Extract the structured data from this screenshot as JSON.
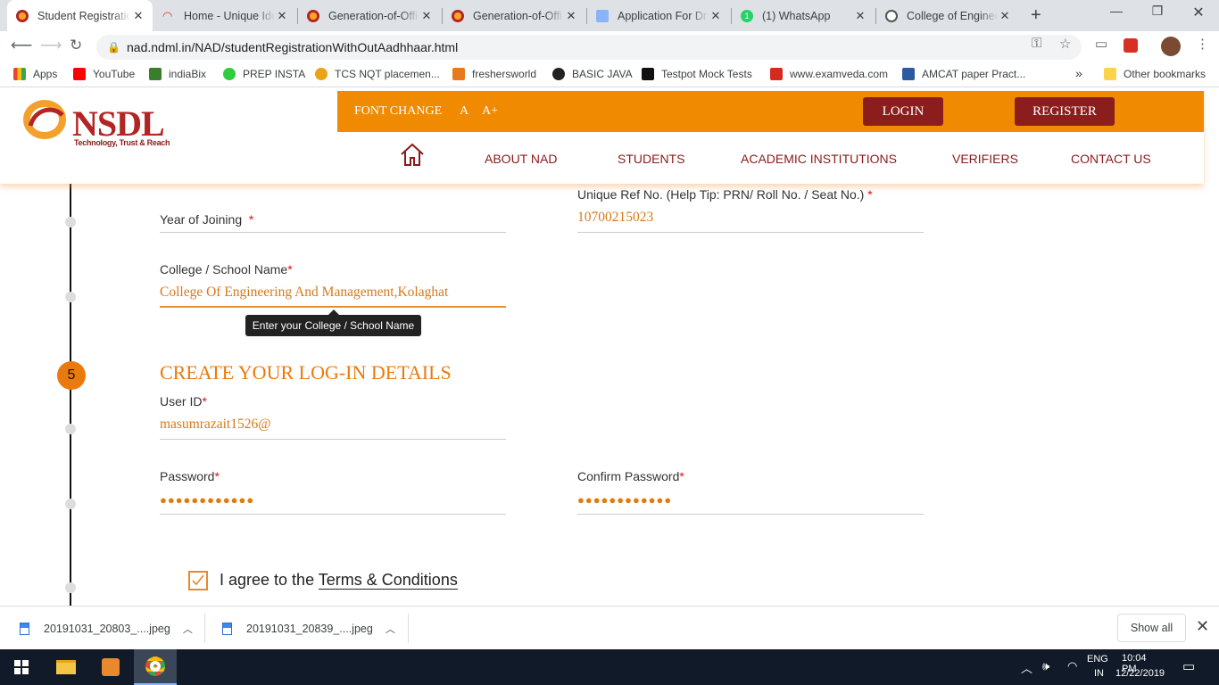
{
  "browser": {
    "tabs": [
      {
        "title": "Student Registratio",
        "active": true,
        "favicon": "nsdl-logo-icon"
      },
      {
        "title": "Home - Unique Ide",
        "active": false,
        "favicon": "wifi-icon"
      },
      {
        "title": "Generation-of-Offi",
        "active": false,
        "favicon": "nsdl-logo-icon"
      },
      {
        "title": "Generation-of-Offi",
        "active": false,
        "favicon": "nsdl-logo-icon"
      },
      {
        "title": "Application For Dr",
        "active": false,
        "favicon": "document-icon"
      },
      {
        "title": "(1) WhatsApp",
        "active": false,
        "favicon": "whatsapp-icon"
      },
      {
        "title": "College of Enginee",
        "active": false,
        "favicon": "college-icon"
      }
    ],
    "url": "nad.ndml.in/NAD/studentRegistrationWithOutAadhhaar.html",
    "bookmarks": [
      {
        "label": "Apps",
        "icon": "apps-grid-icon",
        "color": "#ea4335"
      },
      {
        "label": "YouTube",
        "icon": "youtube-icon",
        "color": "#ff0000"
      },
      {
        "label": "indiaBix",
        "icon": "indiabix-icon",
        "color": "#3a7d2c"
      },
      {
        "label": "PREP INSTA",
        "icon": "prepinsta-icon",
        "color": "#2ecc40"
      },
      {
        "label": "TCS NQT placemen...",
        "icon": "tcs-icon",
        "color": "#e8a317"
      },
      {
        "label": "freshersworld",
        "icon": "freshersworld-icon",
        "color": "#e87a1d"
      },
      {
        "label": "BASIC JAVA",
        "icon": "java-icon",
        "color": "#222222"
      },
      {
        "label": "Testpot Mock Tests",
        "icon": "testpot-icon",
        "color": "#111111"
      },
      {
        "label": "www.examveda.com",
        "icon": "examveda-icon",
        "color": "#d52b1e"
      },
      {
        "label": "AMCAT paper Pract...",
        "icon": "amcat-icon",
        "color": "#2c5aa0"
      }
    ],
    "more_bookmarks": "»",
    "other_bookmarks": "Other bookmarks"
  },
  "header": {
    "logo_text": "NSDL",
    "logo_tagline": "Technology, Trust & Reach",
    "font_change_label": "FONT CHANGE",
    "font_a": "A",
    "font_a_plus": "A+",
    "login_label": "LOGIN",
    "register_label": "REGISTER",
    "nav": [
      "ABOUT NAD",
      "STUDENTS",
      "ACADEMIC INSTITUTIONS",
      "VERIFIERS",
      "CONTACT US"
    ],
    "accent_color": "#f08a00",
    "button_color": "#8c1d1d"
  },
  "form": {
    "year_of_joining_label": "Year of Joining",
    "year_of_joining_value": "",
    "unique_ref_label": "Unique Ref No.   (Help Tip: PRN/ Roll No. / Seat No.)",
    "unique_ref_value": "10700215023",
    "college_label": "College / School Name",
    "college_value": "College Of Engineering And Management,Kolaghat",
    "college_tooltip": "Enter your College / School Name",
    "step_number": "5",
    "section_title": "CREATE YOUR LOG-IN DETAILS",
    "user_id_label": "User ID",
    "user_id_value": "masumrazait1526@",
    "password_label": "Password",
    "password_value": "●●●●●●●●●●●●",
    "confirm_password_label": "Confirm Password",
    "confirm_password_value": "●●●●●●●●●●●●",
    "required_mark": "*",
    "agree_prefix": "I agree to the ",
    "agree_link": "Terms & Conditions",
    "agree_checked": true
  },
  "downloads": {
    "items": [
      {
        "filename": "20191031_20803_....jpeg"
      },
      {
        "filename": "20191031_20839_....jpeg"
      }
    ],
    "show_all_label": "Show all"
  },
  "taskbar": {
    "language": "ENG",
    "region": "IN",
    "time": "10:04 PM",
    "date": "12/22/2019"
  }
}
